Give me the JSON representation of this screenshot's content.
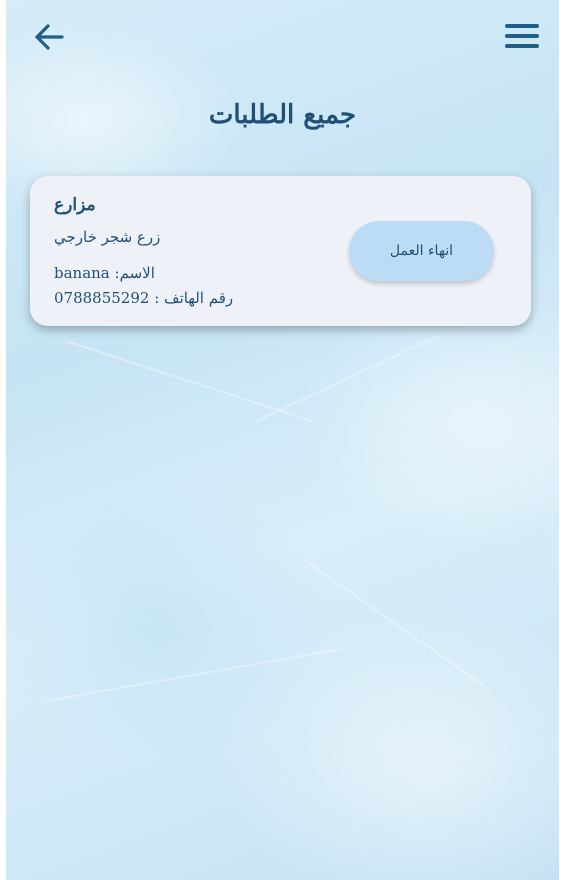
{
  "header": {
    "back_icon": "arrow-left-icon",
    "menu_icon": "hamburger-menu-icon",
    "title": "جميع الطلبات"
  },
  "order": {
    "title": "مزارع",
    "description": "زرع شجر خارجي",
    "name_label": "الاسم:",
    "name_value": "banana",
    "phone_label": "رقم الهاتف :",
    "phone_value": "0788855292",
    "action_label": "انهاء العمل"
  },
  "colors": {
    "accent": "#1f5077",
    "card_background": "#eef2f8",
    "button_background": "#bcdcf6",
    "page_background": "#cfe8f6"
  }
}
